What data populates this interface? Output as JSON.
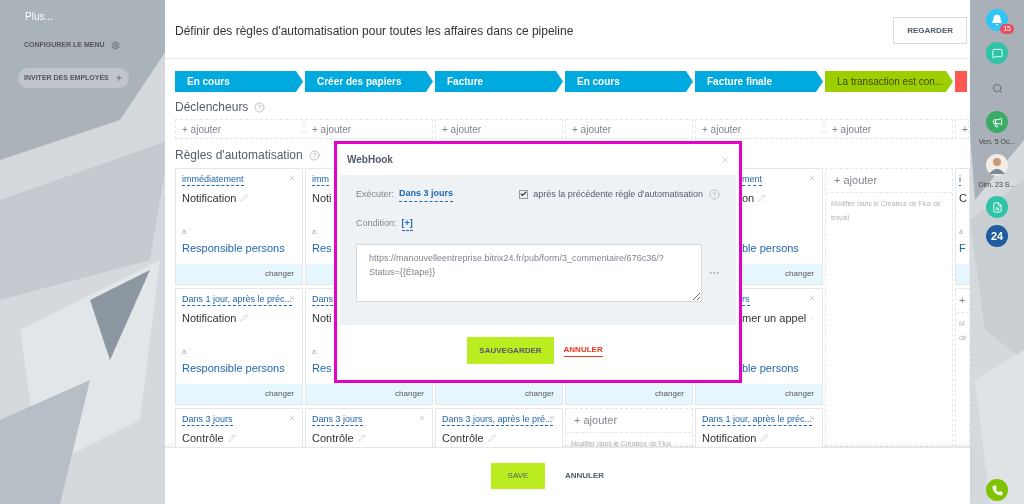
{
  "sidebar": {
    "items": [
      {
        "label": "Plus...",
        "kind": "more"
      },
      {
        "label": "CONFIGURER LE MENU",
        "kind": "settings"
      },
      {
        "label": "INVITER DES EMPLOYÉS",
        "kind": "invite"
      }
    ]
  },
  "header": {
    "title": "Définir des règles d'automatisation pour toutes les affaires dans ce pipeline",
    "button": "REGARDER"
  },
  "stages": [
    {
      "label": "En cours",
      "kind": "progress"
    },
    {
      "label": "Créer des papiers",
      "kind": "progress"
    },
    {
      "label": "Facture",
      "kind": "progress"
    },
    {
      "label": "En cours",
      "kind": "progress"
    },
    {
      "label": "Facture finale",
      "kind": "progress"
    },
    {
      "label": "La transaction est con...",
      "kind": "success"
    },
    {
      "kind": "failure"
    }
  ],
  "triggers": {
    "title": "Déclencheurs",
    "add_buttons": [
      "+ ajouter",
      "+ ajouter",
      "+ ajouter",
      "+ ajouter",
      "+ ajouter",
      "+ ajouter",
      "+"
    ]
  },
  "rules": {
    "title": "Règles d'automatisation",
    "columns": [
      {
        "items": [
          {
            "kind": "rule",
            "delay": "immédiatement",
            "title": "Notification",
            "editable": true,
            "removable": true,
            "to_label": "à:",
            "recipient": "Responsible persons",
            "footer": "changer"
          },
          {
            "kind": "rule",
            "delay": "Dans 1 jour, après le préc...",
            "title": "Notification",
            "editable": true,
            "removable": true,
            "to_label": "à:",
            "recipient": "Responsible persons",
            "footer": "changer"
          },
          {
            "kind": "rule",
            "delay": "Dans 3 jours",
            "title": "Contrôle",
            "editable": true,
            "removable": true
          }
        ]
      },
      {
        "items": [
          {
            "kind": "rule",
            "delay": "imm",
            "title": "Noti",
            "editable": false,
            "removable": false,
            "to_label": "à:",
            "recipient": "Res"
          },
          {
            "kind": "rule",
            "delay": "Dans",
            "title": "Noti",
            "editable": false,
            "removable": false,
            "to_label": "à:",
            "recipient": "Res",
            "footer": "changer"
          },
          {
            "kind": "rule",
            "delay": "Dans 3 jours",
            "title": "Contrôle",
            "editable": true,
            "removable": true
          }
        ]
      },
      {
        "items": [
          {
            "kind": "hidden"
          },
          {
            "kind": "hidden",
            "footer": "changer"
          },
          {
            "kind": "rule",
            "delay": "Dans 3 jours, après le pré...",
            "title": "Contrôle",
            "editable": true,
            "removable": true
          }
        ]
      },
      {
        "items": [
          {
            "kind": "hidden"
          },
          {
            "kind": "hidden",
            "footer": "changer"
          },
          {
            "kind": "add",
            "label": "+ ajouter",
            "hint": "Modifier dans le Créateur de Flux"
          }
        ]
      },
      {
        "items": [
          {
            "kind": "rule_partial",
            "delay": "ment",
            "title": "on",
            "editable": true,
            "removable": true,
            "recipient": "ble persons",
            "footer": "changer"
          },
          {
            "kind": "rule_partial",
            "delay": "rs",
            "title": "mer un appel",
            "editable": true,
            "removable": true,
            "recipient": "ble persons",
            "footer": "changer"
          },
          {
            "kind": "rule",
            "delay": "Dans 1 jour, après le préc...",
            "title": "Notification",
            "editable": true,
            "removable": true
          }
        ]
      },
      {
        "items": [
          {
            "kind": "add",
            "label": "+ ajouter",
            "hint": "Modifier dans le Créateur de Flux de travail"
          }
        ]
      },
      {
        "items": [
          {
            "kind": "rule",
            "delay": "i",
            "title": "C",
            "editable": false,
            "removable": false,
            "to_label": "à",
            "recipient": "F"
          },
          {
            "kind": "add",
            "label": "+",
            "hint": "M de"
          }
        ]
      }
    ]
  },
  "dialog": {
    "title": "WebHook",
    "execute_label": "Exécuter:",
    "execute_value": "Dans 3 jours",
    "after_previous": {
      "label": "après la précédente règle d'automatisation",
      "checked": true
    },
    "condition_label": "Condition:",
    "condition_value": "[+]",
    "url": "https://manouvelleentreprise.bitrix24.fr/pub/form/3_commentaire/676c36/?Status={{Étape}}",
    "save": "SAUVEGARDER",
    "cancel": "ANNULER"
  },
  "right_bar": {
    "notifications": "15",
    "dates": [
      "Ven. 5 Oc...",
      "Dim. 23 S..."
    ],
    "logo": "24"
  },
  "footer": {
    "save": "SAVE",
    "cancel": "ANNULER"
  }
}
